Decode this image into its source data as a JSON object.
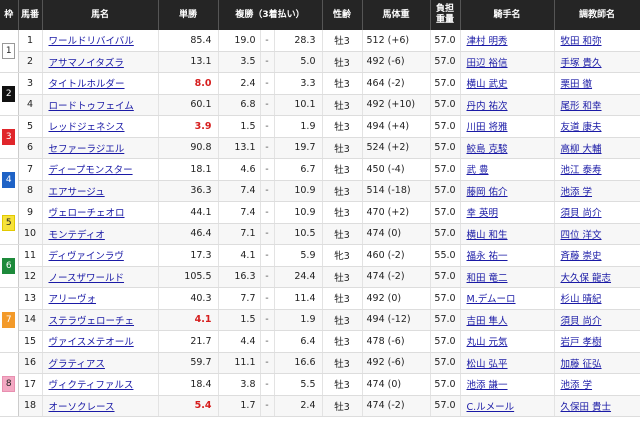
{
  "headers": {
    "waku": "枠",
    "umaban": "馬番",
    "name": "馬名",
    "tansho": "単勝",
    "fukusho": "複勝（3着払い）",
    "sexage": "性齢",
    "weight": "馬体重",
    "kinryo_1": "負担",
    "kinryo_2": "重量",
    "jockey": "騎手名",
    "trainer": "調教師名"
  },
  "colors": {
    "header_bg": "#252525",
    "favorite_odds": "#d61d1d",
    "link": "#1a1aa6"
  },
  "waku_groups": [
    {
      "waku": "1",
      "rowspan": 2,
      "bg": "#ffffff",
      "fg": "#222222",
      "border": "#999999"
    },
    {
      "waku": "2",
      "rowspan": 2,
      "bg": "#111111",
      "fg": "#ffffff",
      "border": "#111111"
    },
    {
      "waku": "3",
      "rowspan": 2,
      "bg": "#e0262b",
      "fg": "#ffffff",
      "border": "#e0262b"
    },
    {
      "waku": "4",
      "rowspan": 2,
      "bg": "#1e62c6",
      "fg": "#ffffff",
      "border": "#1e62c6"
    },
    {
      "waku": "5",
      "rowspan": 2,
      "bg": "#f7e23a",
      "fg": "#222222",
      "border": "#e2c900"
    },
    {
      "waku": "6",
      "rowspan": 2,
      "bg": "#1d8a3b",
      "fg": "#ffffff",
      "border": "#1d8a3b"
    },
    {
      "waku": "7",
      "rowspan": 3,
      "bg": "#f39a2a",
      "fg": "#ffffff",
      "border": "#f39a2a"
    },
    {
      "waku": "8",
      "rowspan": 3,
      "bg": "#f3a9c3",
      "fg": "#222222",
      "border": "#e88fb0"
    }
  ],
  "rows": [
    {
      "umaban": "1",
      "name": "ワールドリバイバル",
      "tansho": "85.4",
      "fav": false,
      "fmin": "19.0",
      "dash": "-",
      "fmax": "28.3",
      "sex": "牡3",
      "weight": "512 (+6)",
      "kinryo": "57.0",
      "jockey": "津村 明秀",
      "trainer": "牧田 和弥"
    },
    {
      "umaban": "2",
      "name": "アサマノイタズラ",
      "tansho": "13.1",
      "fav": false,
      "fmin": "3.5",
      "dash": "-",
      "fmax": "5.0",
      "sex": "牡3",
      "weight": "492 (-6)",
      "kinryo": "57.0",
      "jockey": "田辺 裕信",
      "trainer": "手塚 貴久"
    },
    {
      "umaban": "3",
      "name": "タイトルホルダー",
      "tansho": "8.0",
      "fav": true,
      "fmin": "2.4",
      "dash": "-",
      "fmax": "3.3",
      "sex": "牡3",
      "weight": "464 (-2)",
      "kinryo": "57.0",
      "jockey": "横山 武史",
      "trainer": "栗田 徹"
    },
    {
      "umaban": "4",
      "name": "ロードトゥフェイム",
      "tansho": "60.1",
      "fav": false,
      "fmin": "6.8",
      "dash": "-",
      "fmax": "10.1",
      "sex": "牡3",
      "weight": "492 (+10)",
      "kinryo": "57.0",
      "jockey": "丹内 祐次",
      "trainer": "尾形 和幸"
    },
    {
      "umaban": "5",
      "name": "レッドジェネシス",
      "tansho": "3.9",
      "fav": true,
      "fmin": "1.5",
      "dash": "-",
      "fmax": "1.9",
      "sex": "牡3",
      "weight": "494 (+4)",
      "kinryo": "57.0",
      "jockey": "川田 将雅",
      "trainer": "友道 康夫"
    },
    {
      "umaban": "6",
      "name": "セファーラジエル",
      "tansho": "90.8",
      "fav": false,
      "fmin": "13.1",
      "dash": "-",
      "fmax": "19.7",
      "sex": "牡3",
      "weight": "524 (+2)",
      "kinryo": "57.0",
      "jockey": "鮫島 克駿",
      "trainer": "高柳 大輔"
    },
    {
      "umaban": "7",
      "name": "ディープモンスター",
      "tansho": "18.1",
      "fav": false,
      "fmin": "4.6",
      "dash": "-",
      "fmax": "6.7",
      "sex": "牡3",
      "weight": "450 (-4)",
      "kinryo": "57.0",
      "jockey": "武 豊",
      "trainer": "池江 泰寿"
    },
    {
      "umaban": "8",
      "name": "エアサージュ",
      "tansho": "36.3",
      "fav": false,
      "fmin": "7.4",
      "dash": "-",
      "fmax": "10.9",
      "sex": "牡3",
      "weight": "514 (-18)",
      "kinryo": "57.0",
      "jockey": "藤岡 佑介",
      "trainer": "池添 学"
    },
    {
      "umaban": "9",
      "name": "ヴェローチェオロ",
      "tansho": "44.1",
      "fav": false,
      "fmin": "7.4",
      "dash": "-",
      "fmax": "10.9",
      "sex": "牡3",
      "weight": "470 (+2)",
      "kinryo": "57.0",
      "jockey": "幸 英明",
      "trainer": "須貝 尚介"
    },
    {
      "umaban": "10",
      "name": "モンテディオ",
      "tansho": "46.4",
      "fav": false,
      "fmin": "7.1",
      "dash": "-",
      "fmax": "10.5",
      "sex": "牡3",
      "weight": "474 (0)",
      "kinryo": "57.0",
      "jockey": "横山 和生",
      "trainer": "四位 洋文"
    },
    {
      "umaban": "11",
      "name": "ディヴァインラヴ",
      "tansho": "17.3",
      "fav": false,
      "fmin": "4.1",
      "dash": "-",
      "fmax": "5.9",
      "sex": "牝3",
      "weight": "460 (-2)",
      "kinryo": "55.0",
      "jockey": "福永 祐一",
      "trainer": "斉藤 崇史"
    },
    {
      "umaban": "12",
      "name": "ノースザワールド",
      "tansho": "105.5",
      "fav": false,
      "fmin": "16.3",
      "dash": "-",
      "fmax": "24.4",
      "sex": "牡3",
      "weight": "474 (-2)",
      "kinryo": "57.0",
      "jockey": "和田 竜二",
      "trainer": "大久保 龍志"
    },
    {
      "umaban": "13",
      "name": "アリーヴォ",
      "tansho": "40.3",
      "fav": false,
      "fmin": "7.7",
      "dash": "-",
      "fmax": "11.4",
      "sex": "牡3",
      "weight": "492 (0)",
      "kinryo": "57.0",
      "jockey": "M.デムーロ",
      "trainer": "杉山 晴紀"
    },
    {
      "umaban": "14",
      "name": "ステラヴェローチェ",
      "tansho": "4.1",
      "fav": true,
      "fmin": "1.5",
      "dash": "-",
      "fmax": "1.9",
      "sex": "牡3",
      "weight": "494 (-12)",
      "kinryo": "57.0",
      "jockey": "吉田 隼人",
      "trainer": "須貝 尚介"
    },
    {
      "umaban": "15",
      "name": "ヴァイスメテオール",
      "tansho": "21.7",
      "fav": false,
      "fmin": "4.4",
      "dash": "-",
      "fmax": "6.4",
      "sex": "牡3",
      "weight": "478 (-6)",
      "kinryo": "57.0",
      "jockey": "丸山 元気",
      "trainer": "岩戸 孝樹"
    },
    {
      "umaban": "16",
      "name": "グラティアス",
      "tansho": "59.7",
      "fav": false,
      "fmin": "11.1",
      "dash": "-",
      "fmax": "16.6",
      "sex": "牡3",
      "weight": "492 (-6)",
      "kinryo": "57.0",
      "jockey": "松山 弘平",
      "trainer": "加藤 征弘"
    },
    {
      "umaban": "17",
      "name": "ヴィクティファルス",
      "tansho": "18.4",
      "fav": false,
      "fmin": "3.8",
      "dash": "-",
      "fmax": "5.5",
      "sex": "牡3",
      "weight": "474 (0)",
      "kinryo": "57.0",
      "jockey": "池添 謙一",
      "trainer": "池添 学"
    },
    {
      "umaban": "18",
      "name": "オーソクレース",
      "tansho": "5.4",
      "fav": true,
      "fmin": "1.7",
      "dash": "-",
      "fmax": "2.4",
      "sex": "牡3",
      "weight": "474 (-2)",
      "kinryo": "57.0",
      "jockey": "C.ルメール",
      "trainer": "久保田 貴士"
    }
  ]
}
